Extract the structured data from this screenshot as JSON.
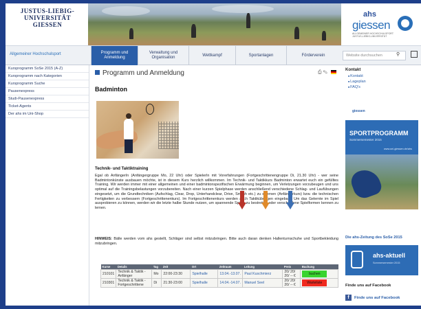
{
  "header": {
    "uni_line1": "JUSTUS-LIEBIG-",
    "uni_line2": "UNIVERSITÄT",
    "uni_line3": "GIESSEN",
    "ahs_small": "ahs",
    "ahs_big": "giessen",
    "ahs_tagline": "ALLGEMEINER HOCHSCHULSPORT JUSTUS-LIEBIG-UNIVERSITÄT"
  },
  "nav": {
    "home": "Allgemeiner Hochschulsport",
    "tabs": [
      {
        "label": "Programm und Anmeldung"
      },
      {
        "label": "Verwaltung und Organisation"
      },
      {
        "label": "Wettkampf"
      },
      {
        "label": "Sportanlagen"
      },
      {
        "label": "Förderverein"
      }
    ],
    "search_placeholder": "Website durchsuchen"
  },
  "sidebar": {
    "items": [
      {
        "label": "Kursprogramm SoSe 2015 (A-Z)"
      },
      {
        "label": "Kursprogramm nach Kategorien"
      },
      {
        "label": "Kursprogramm Suche"
      },
      {
        "label": "Pausenexpress"
      },
      {
        "label": "Studi-Pausenexpress"
      },
      {
        "label": "Ticket-Agents"
      },
      {
        "label": "Der ahs im Uni-Shop"
      }
    ]
  },
  "main": {
    "page_title": "Programm und Anmeldung",
    "course_title": "Badminton",
    "section_title": "Technik- und Taktiktraining",
    "paragraph": "Egal ob AnfängerIn (Anfängergruppe Mo, 22 Uhr) oder SpielerIn mit Vorerfahrungen (Fortgeschrittenengruppe Di, 21.30 Uhr) - wer seine Badmintonkünste ausbauen möchte, ist in diesem Kurs herzlich willkommen. Im Technik- und Taktikkurs Badminton erwartet euch ein gefülltes Training. Wir werden immer mit einer allgemeinen und einer badmintonspezifischen Erwärmung beginnen, um Verletzungen vorzubeugen und uns optimal auf die Trainingsbelastungen vorzubereiten. Nach einer kurzen Spielphase werden anschließend verschiedene Schlag- und Laufübungen eingesetzt, um die Grundtechniken (Aufschlag, Clear, Drop, Unterhandclear, Drive, Smash etc.) zu erlernen (Anfängerkurs) bzw. die technischen Fertigkeiten zu verbessern (Fortgeschrittenenkurs). Im Fortgeschrittenenkurs werden auch Taktikübungen eingebaut. Um das Gelernte im Spiel ausprobieren zu können, werden wir die letzte halbe Stunde nutzen, um spannende Spiele zu bestreiten oder verschiedene Spielformen kennen zu lernen.",
    "hint_label": "HINWEIS:",
    "hint_text": "Bälle werden vom ahs gestellt, Schläger sind selbst mitzubringen. Bitte auch daran denken Hallenturnschuhe und Sportbekleidung mitzubringen."
  },
  "arrows": {
    "colors": [
      "#b8342a",
      "#e08a2a",
      "#3d6fb3"
    ]
  },
  "table": {
    "headers": [
      "Kurse",
      "Details",
      "Tag",
      "Zeit",
      "Ort",
      "Zeitraum",
      "Leitung",
      "Preis",
      "Buchung"
    ],
    "rows": [
      {
        "nr": "210101",
        "details": "Technik & Taktik - Anfänger",
        "tag": "Mo",
        "zeit": "22:00-23:30",
        "ort": "Spielhalle",
        "zeitraum": "13.04.-13.07.",
        "leitung": "Paul Kuschmierz",
        "preis": "20/ 20/ 20/ -- €",
        "buchung": "buchen",
        "color": "#39d42f"
      },
      {
        "nr": "210301",
        "details": "Technik & Taktik - Fortgeschrittene",
        "tag": "Di",
        "zeit": "21:30-23:00",
        "ort": "Spielhalle",
        "zeitraum": "14.04.-14.07.",
        "leitung": "Manuel Seel",
        "preis": "20/ 20/ 20/ -- €",
        "buchung": "Warteliste",
        "color": "#f0291e"
      }
    ]
  },
  "right": {
    "kontakt_title": "Kontakt",
    "links": [
      {
        "label": "Kontakt"
      },
      {
        "label": "Lageplan"
      },
      {
        "label": "FAQ's"
      }
    ],
    "promo_title": "SPORTPROGRAMM",
    "promo_semester": "Sommersemester 2015",
    "promo_url": "www.uni-giessen.de/ahs",
    "zeitung": "Die ahs-Zeitung des SoSe 2015",
    "aktuell_title": "ahs-aktuell",
    "aktuell_sub": "Sommersemester 2015",
    "fb_heading": "Finde uns auf Facebook",
    "fb_link": "Finde uns auf Facebook"
  }
}
